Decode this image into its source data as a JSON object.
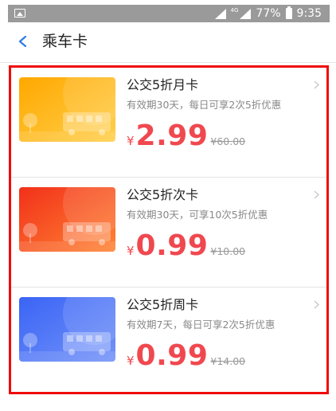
{
  "status_bar": {
    "network": "4G",
    "battery_percent": "77%",
    "time": "9:35"
  },
  "header": {
    "title": "乘车卡"
  },
  "cards": [
    {
      "title": "公交5折月卡",
      "description": "有效期30天，每日可享2次5折优惠",
      "currency": "¥",
      "price": "2.99",
      "original_price": "¥60.00",
      "theme": "yellow",
      "colors": [
        "#ffb300",
        "#ffc83d"
      ]
    },
    {
      "title": "公交5折次卡",
      "description": "有效期30天，可享10次5折优惠",
      "currency": "¥",
      "price": "0.99",
      "original_price": "¥10.00",
      "theme": "orange",
      "colors": [
        "#f53a1c",
        "#ff7a33"
      ]
    },
    {
      "title": "公交5折周卡",
      "description": "有效期7天，每日可享2次5折优惠",
      "currency": "¥",
      "price": "0.99",
      "original_price": "¥14.00",
      "theme": "blue",
      "colors": [
        "#3f6cf6",
        "#6f8ff8"
      ]
    }
  ],
  "accent_color": "#f0484f",
  "highlight_color": "#f00a0a"
}
